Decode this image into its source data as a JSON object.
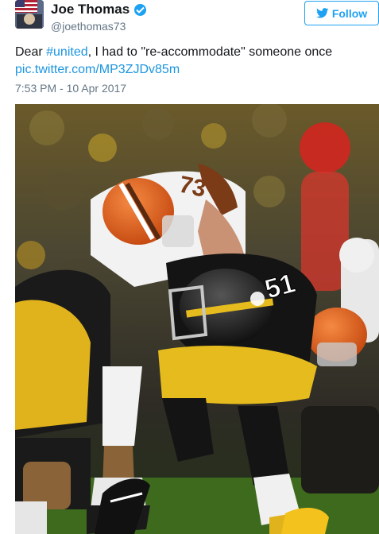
{
  "author": {
    "display_name": "Joe Thomas",
    "handle": "@joethomas73",
    "verified": true,
    "avatar_icon": "flag-avatar-icon"
  },
  "follow_button": {
    "label": "Follow",
    "icon": "twitter-bird-icon",
    "color": "#1da1f2"
  },
  "tweet": {
    "text_prefix": "Dear ",
    "hashtag": "#united",
    "text_suffix": ", I had to \"re-accommodate\" someone once",
    "link": "pic.twitter.com/MP3ZJDv85m",
    "timestamp": "7:53 PM - 10 Apr 2017"
  },
  "photo": {
    "jersey_numbers": [
      "73",
      "51"
    ],
    "colors": {
      "browns_helmet": "#e2621f",
      "steelers_gold": "#f2c318",
      "steelers_black": "#1a1a1a"
    }
  },
  "colors": {
    "link": "#1b95e0",
    "muted": "#657786",
    "text": "#14171a"
  }
}
